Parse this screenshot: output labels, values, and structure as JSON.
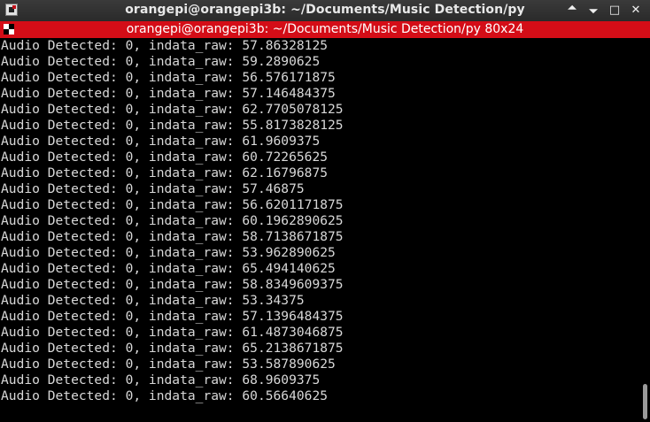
{
  "window": {
    "title": "orangepi@orangepi3b: ~/Documents/Music Detection/py",
    "controls": [
      "🞁",
      "🞃",
      "□",
      "✕"
    ]
  },
  "tab": {
    "label": "orangepi@orangepi3b: ~/Documents/Music Detection/py 80x24"
  },
  "terminal": {
    "lines": [
      "Audio Detected: 0, indata_raw: 57.86328125",
      "Audio Detected: 0, indata_raw: 59.2890625",
      "Audio Detected: 0, indata_raw: 56.576171875",
      "Audio Detected: 0, indata_raw: 57.146484375",
      "Audio Detected: 0, indata_raw: 62.7705078125",
      "Audio Detected: 0, indata_raw: 55.8173828125",
      "Audio Detected: 0, indata_raw: 61.9609375",
      "Audio Detected: 0, indata_raw: 60.72265625",
      "Audio Detected: 0, indata_raw: 62.16796875",
      "Audio Detected: 0, indata_raw: 57.46875",
      "Audio Detected: 0, indata_raw: 56.6201171875",
      "Audio Detected: 0, indata_raw: 60.1962890625",
      "Audio Detected: 0, indata_raw: 58.7138671875",
      "Audio Detected: 0, indata_raw: 53.962890625",
      "Audio Detected: 0, indata_raw: 65.494140625",
      "Audio Detected: 0, indata_raw: 58.8349609375",
      "Audio Detected: 0, indata_raw: 53.34375",
      "Audio Detected: 0, indata_raw: 57.1396484375",
      "Audio Detected: 0, indata_raw: 61.4873046875",
      "Audio Detected: 0, indata_raw: 65.2138671875",
      "Audio Detected: 0, indata_raw: 53.587890625",
      "Audio Detected: 0, indata_raw: 68.9609375",
      "Audio Detected: 0, indata_raw: 60.56640625"
    ]
  },
  "colors": {
    "tab_bar": "#d40d17",
    "title_bar": "#2f2f2f",
    "terminal_bg": "#000000",
    "terminal_fg": "#d8d8d8"
  },
  "icons": {
    "app": "terminal-app-icon",
    "tab": "tab-terminal-icon"
  }
}
